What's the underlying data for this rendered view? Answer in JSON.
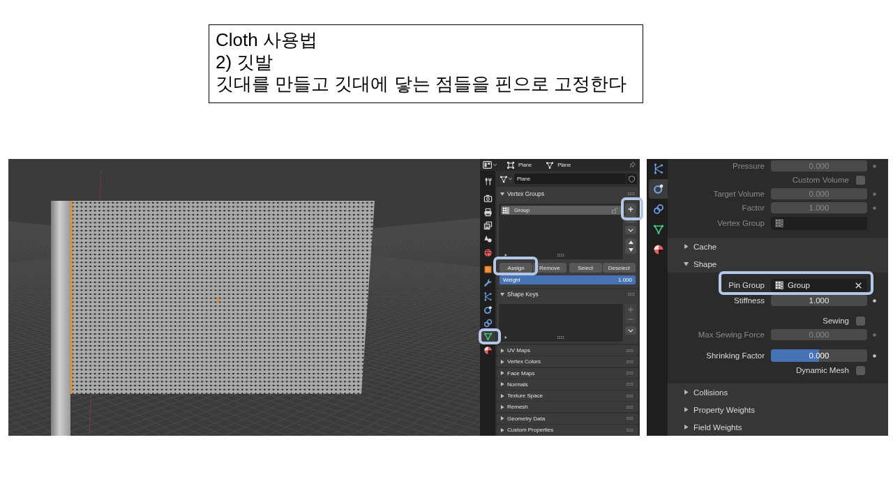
{
  "caption": {
    "lines": [
      "Cloth 사용법",
      "2) 깃발",
      "깃대를 만들고 깃대에 닿는 점들을 핀으로 고정한다"
    ]
  },
  "mesh_properties": {
    "breadcrumbs": [
      {
        "kind": "object",
        "label": "Plane"
      },
      {
        "kind": "mesh",
        "label": "Plane"
      }
    ],
    "tab_groups": [
      {
        "tabs": [
          {
            "kind": "tool",
            "selected": false,
            "highlighted": false
          }
        ]
      },
      {
        "tabs": [
          {
            "kind": "render",
            "selected": false,
            "highlighted": false
          },
          {
            "kind": "output",
            "selected": false,
            "highlighted": false
          },
          {
            "kind": "view_layer",
            "selected": false,
            "highlighted": false
          },
          {
            "kind": "scene",
            "selected": false,
            "highlighted": false
          },
          {
            "kind": "world",
            "selected": false,
            "highlighted": false
          }
        ]
      },
      {
        "tabs": [
          {
            "kind": "object",
            "selected": false,
            "highlighted": false
          },
          {
            "kind": "modifiers",
            "selected": false,
            "highlighted": false
          },
          {
            "kind": "particles",
            "selected": false,
            "highlighted": false
          },
          {
            "kind": "physics",
            "selected": false,
            "highlighted": false
          },
          {
            "kind": "constraints",
            "selected": false,
            "highlighted": false
          },
          {
            "kind": "data",
            "selected": true,
            "highlighted": true
          },
          {
            "kind": "material",
            "selected": false,
            "highlighted": false
          }
        ]
      }
    ],
    "mesh_name": "Plane",
    "vertex_groups": {
      "title": "Vertex Groups",
      "expanded": true,
      "items": [
        {
          "name": "Group",
          "selected": true
        }
      ],
      "side_buttons": [
        {
          "kind": "add",
          "disabled": false,
          "highlighted": true
        },
        {
          "kind": "remove",
          "disabled": false,
          "highlighted": false
        },
        {
          "kind": "menu",
          "disabled": false,
          "highlighted": false
        },
        {
          "kind": "move_up",
          "disabled": false,
          "highlighted": false
        },
        {
          "kind": "move_down",
          "disabled": false,
          "highlighted": false
        }
      ],
      "actions": [
        {
          "label": "Assign",
          "highlighted": true
        },
        {
          "label": "Remove",
          "highlighted": false
        },
        {
          "label": "Select",
          "highlighted": false
        },
        {
          "label": "Deselect",
          "highlighted": false
        }
      ],
      "weight": {
        "label": "Weight",
        "value": "1.000",
        "level": 1
      }
    },
    "shape_keys": {
      "title": "Shape Keys",
      "expanded": true,
      "side_buttons": [
        {
          "kind": "add",
          "disabled": true,
          "highlighted": false
        },
        {
          "kind": "remove",
          "disabled": true,
          "highlighted": false
        },
        {
          "kind": "menu",
          "disabled": false,
          "highlighted": false
        }
      ]
    },
    "panels": [
      {
        "title": "UV Maps",
        "expanded": false
      },
      {
        "title": "Vertex Colors",
        "expanded": false
      },
      {
        "title": "Face Maps",
        "expanded": false
      },
      {
        "title": "Normals",
        "expanded": false
      },
      {
        "title": "Texture Space",
        "expanded": false
      },
      {
        "title": "Remesh",
        "expanded": false
      },
      {
        "title": "Geometry Data",
        "expanded": false
      },
      {
        "title": "Custom Properties",
        "expanded": false
      }
    ]
  },
  "cloth_properties": {
    "tabs": [
      {
        "kind": "particles",
        "selected": false
      },
      {
        "kind": "physics",
        "selected": true
      },
      {
        "kind": "constraints",
        "selected": false
      },
      {
        "kind": "data",
        "selected": false
      },
      {
        "kind": "material",
        "selected": false
      }
    ],
    "pressure_rows": [
      {
        "kind": "number",
        "label": "Pressure",
        "value": "0.000",
        "disabled": true
      },
      {
        "kind": "checkbox",
        "label": "Custom Volume",
        "checked": false,
        "disabled": true
      },
      {
        "kind": "number",
        "label": "Target Volume",
        "value": "0.000",
        "disabled": true
      },
      {
        "kind": "number",
        "label": "Factor",
        "value": "1.000",
        "disabled": true
      },
      {
        "kind": "search",
        "label": "Vertex Group",
        "disabled": true
      }
    ],
    "sections": [
      {
        "title": "Cache",
        "expanded": false
      },
      {
        "title": "Shape",
        "expanded": true,
        "groups": [
          {
            "rows": [
              {
                "kind": "search",
                "label": "Pin Group",
                "value": "Group",
                "disabled": false,
                "highlighted": true
              },
              {
                "kind": "number",
                "label": "Stiffness",
                "value": "1.000",
                "disabled": false,
                "highlighted": false
              }
            ]
          },
          {
            "rows": [
              {
                "kind": "checkbox",
                "label": "Sewing",
                "checked": false,
                "disabled": false,
                "highlighted": false
              },
              {
                "kind": "number",
                "label": "Max Sewing Force",
                "value": "0.000",
                "disabled": true,
                "highlighted": false
              }
            ]
          },
          {
            "rows": [
              {
                "kind": "slider",
                "label": "Shrinking Factor",
                "value": "0.000",
                "level": 0.5,
                "disabled": false,
                "highlighted": false
              },
              {
                "kind": "checkbox",
                "label": "Dynamic Mesh",
                "checked": false,
                "disabled": false,
                "highlighted": false
              }
            ]
          }
        ]
      },
      {
        "title": "Collisions",
        "expanded": false
      },
      {
        "title": "Property Weights",
        "expanded": false
      },
      {
        "title": "Field Weights",
        "expanded": false
      }
    ]
  }
}
